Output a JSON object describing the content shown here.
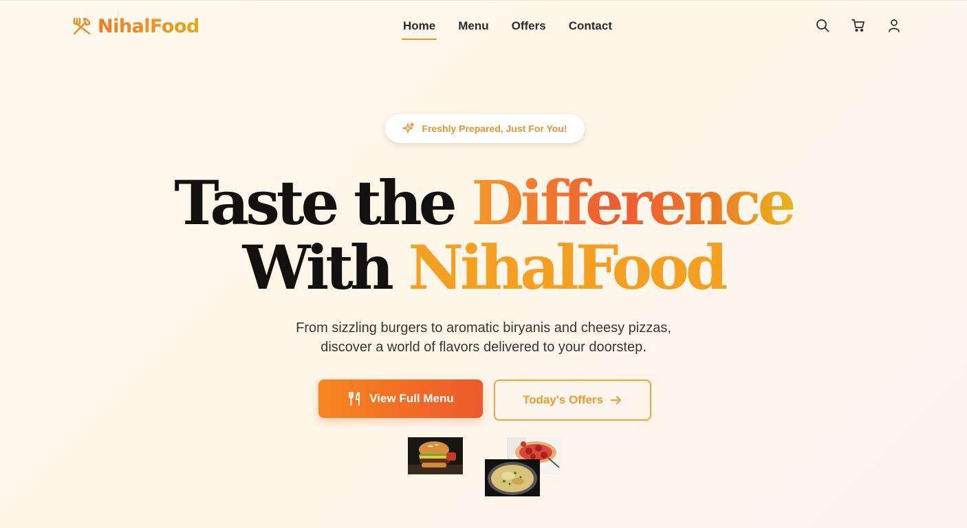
{
  "brand": {
    "name": "NihalFood",
    "logo_icon": "fork-knife-crossed-icon",
    "color": "#f29320"
  },
  "nav": {
    "items": [
      {
        "label": "Home",
        "active": true
      },
      {
        "label": "Menu",
        "active": false
      },
      {
        "label": "Offers",
        "active": false
      },
      {
        "label": "Contact",
        "active": false
      }
    ],
    "icons": [
      "search-icon",
      "cart-icon",
      "user-icon"
    ]
  },
  "hero": {
    "badge": {
      "text": "Freshly Prepared, Just For You!",
      "icon": "sparkles-icon"
    },
    "headline": {
      "line1_plain": "Taste the",
      "line1_highlight": "Difference",
      "line2_plain": "With",
      "line2_highlight": "NihalFood"
    },
    "subtext": {
      "line1": "From sizzling burgers to aromatic biryanis and cheesy pizzas,",
      "line2": "discover a world of flavors delivered to your doorstep."
    },
    "primary_button": {
      "label": "View Full Menu",
      "icon": "utensils-icon"
    },
    "secondary_button": {
      "label": "Today's Offers",
      "icon": "arrow-right-icon"
    }
  },
  "food_images": [
    {
      "name": "burger-image"
    },
    {
      "name": "pizza-image"
    },
    {
      "name": "biryani-image"
    }
  ],
  "colors": {
    "accent": "#f29320",
    "accent_dark": "#ec5a2c",
    "gradient_headline": [
      "#f49a2a",
      "#ef5a35",
      "#e8b41a"
    ],
    "text_dark": "#121110",
    "background": "#fff8ec"
  }
}
